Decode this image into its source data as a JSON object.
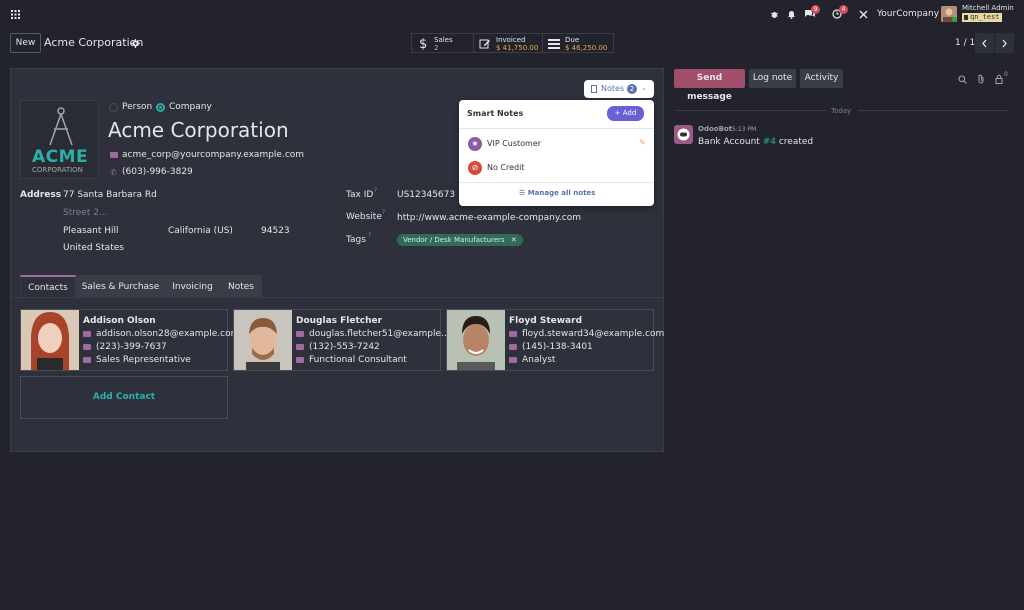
{
  "topbar": {
    "bug_badge": "",
    "messages_badge": "9",
    "activity_badge": "4",
    "company": "YourCompany",
    "user_name": "Mitchell Admin",
    "db_name": "qn_test"
  },
  "control": {
    "new_label": "New",
    "record_title": "Acme Corporation",
    "stats": [
      {
        "label": "Sales",
        "value": "2"
      },
      {
        "label": "Invoiced",
        "value": "$ 41,750.00"
      },
      {
        "label": "Due",
        "value": "$ 46,250.00"
      }
    ],
    "pager": "1 / 1"
  },
  "form": {
    "type_person": "Person",
    "type_company": "Company",
    "logo_text_top": "ACME",
    "logo_text_bottom": "CORPORATION",
    "name": "Acme Corporation",
    "email": "acme_corp@yourcompany.example.com",
    "phone": "(603)-996-3829",
    "address_label": "Address",
    "street": "77 Santa Barbara Rd",
    "street2_placeholder": "Street 2...",
    "city": "Pleasant Hill",
    "state": "California (US)",
    "zip": "94523",
    "country": "United States",
    "tax_label": "Tax ID",
    "tax_value": "US12345673",
    "website_label": "Website",
    "website_value": "http://www.acme-example-company.com",
    "tags_label": "Tags",
    "tag": "Vendor / Desk Manufacturers",
    "help_mark": "?"
  },
  "notes_button": {
    "label": "Notes",
    "count": "2"
  },
  "smart_notes": {
    "title": "Smart Notes",
    "add_label": "Add",
    "items": [
      "VIP Customer",
      "No Credit"
    ],
    "manage_label": "Manage all notes"
  },
  "tabs": [
    "Contacts",
    "Sales & Purchase",
    "Invoicing",
    "Notes"
  ],
  "contacts": [
    {
      "name": "Addison Olson",
      "email": "addison.olson28@example.com",
      "phone": "(223)-399-7637",
      "job": "Sales Representative"
    },
    {
      "name": "Douglas Fletcher",
      "email": "douglas.fletcher51@example.…",
      "phone": "(132)-553-7242",
      "job": "Functional Consultant"
    },
    {
      "name": "Floyd Steward",
      "email": "floyd.steward34@example.com",
      "phone": "(145)-138-3401",
      "job": "Analyst"
    }
  ],
  "add_contact": "Add Contact",
  "chatter": {
    "send_message": "Send message",
    "log_note": "Log note",
    "activity": "Activity",
    "followers_count": "0",
    "today": "Today",
    "author": "OdooBot",
    "time": "5:13 PM",
    "message_prefix": "Bank Account",
    "message_link": "#4",
    "message_suffix": "created"
  }
}
